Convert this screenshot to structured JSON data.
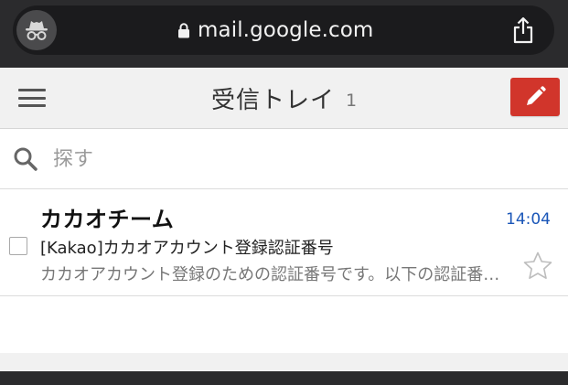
{
  "browser": {
    "url": "mail.google.com",
    "incognito_icon": "incognito-icon",
    "lock_icon": "lock-icon",
    "share_icon": "share-icon"
  },
  "header": {
    "menu_icon": "hamburger-menu-icon",
    "title": "受信トレイ",
    "unread_count": "1",
    "compose_icon": "pencil-icon",
    "compose_color": "#d1352b"
  },
  "search": {
    "placeholder": "探す",
    "value": ""
  },
  "inbox": {
    "messages": [
      {
        "sender": "カカオチーム",
        "time": "14:04",
        "subject": "[Kakao]カカオアカウント登録認証番号",
        "snippet": "カカオアカウント登録のための認証番号です。以下の認証番号を入力してください。",
        "starred": false,
        "checked": false
      }
    ]
  },
  "colors": {
    "time": "#1a56b8",
    "chrome": "#2b2b2d",
    "header_bg": "#f1f1f1"
  }
}
